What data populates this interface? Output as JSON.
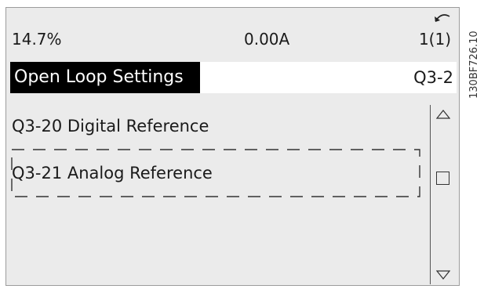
{
  "status": {
    "left": "14.7%",
    "middle": "0.00A",
    "right": "1(1)"
  },
  "icons": {
    "back": "back-arrow-icon",
    "up": "scroll-up-icon",
    "down": "scroll-down-icon"
  },
  "menu": {
    "title": "Open Loop Settings",
    "code": "Q3-2",
    "items": [
      {
        "label": "Q3-20 Digital Reference"
      },
      {
        "label": "Q3-21 Analog Reference"
      }
    ]
  },
  "side_code": "130BF726.10"
}
